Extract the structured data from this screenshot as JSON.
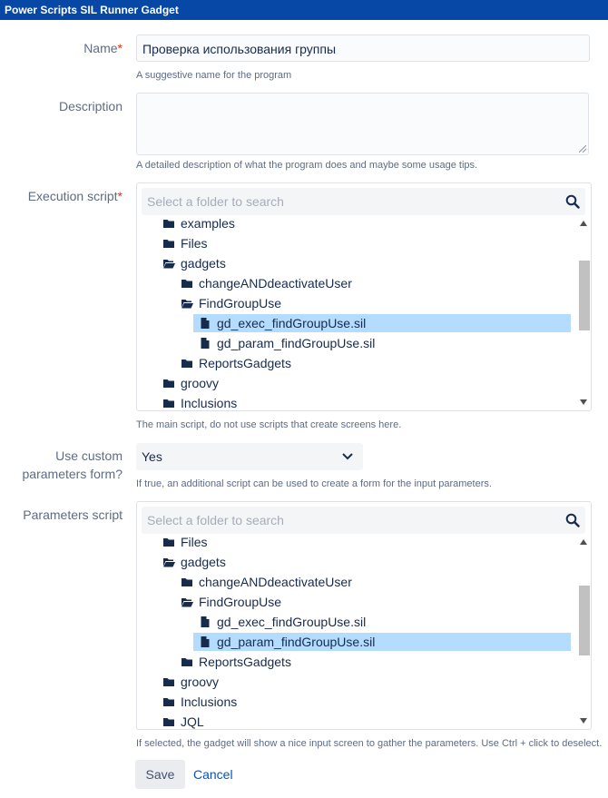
{
  "title": "Power Scripts SIL Runner Gadget",
  "name": {
    "label": "Name",
    "required": "*",
    "value": "Проверка использования группы",
    "hint": "A suggestive name for the program"
  },
  "description": {
    "label": "Description",
    "value": "",
    "hint": "A detailed description of what the program does and maybe some usage tips."
  },
  "execution_script": {
    "label": "Execution script",
    "required": "*",
    "search_placeholder": "Select a folder to search",
    "items": [
      {
        "label": "examples",
        "type": "folder"
      },
      {
        "label": "Files",
        "type": "folder"
      },
      {
        "label": "gadgets",
        "type": "folder-open"
      },
      {
        "label": "changeANDdeactivateUser",
        "type": "folder"
      },
      {
        "label": "FindGroupUse",
        "type": "folder-open"
      },
      {
        "label": "gd_exec_findGroupUse.sil",
        "type": "file",
        "selected": true
      },
      {
        "label": "gd_param_findGroupUse.sil",
        "type": "file"
      },
      {
        "label": "ReportsGadgets",
        "type": "folder"
      },
      {
        "label": "groovy",
        "type": "folder"
      },
      {
        "label": "Inclusions",
        "type": "folder"
      }
    ],
    "hint": "The main script, do not use scripts that create screens here."
  },
  "custom_params": {
    "label_line1": "Use custom",
    "label_line2": "parameters form?",
    "value": "Yes",
    "hint": "If true, an additional script can be used to create a form for the input parameters."
  },
  "parameters_script": {
    "label": "Parameters script",
    "search_placeholder": "Select a folder to search",
    "items": [
      {
        "label": "Files",
        "type": "folder"
      },
      {
        "label": "gadgets",
        "type": "folder-open"
      },
      {
        "label": "changeANDdeactivateUser",
        "type": "folder"
      },
      {
        "label": "FindGroupUse",
        "type": "folder-open"
      },
      {
        "label": "gd_exec_findGroupUse.sil",
        "type": "file"
      },
      {
        "label": "gd_param_findGroupUse.sil",
        "type": "file",
        "selected": true
      },
      {
        "label": "ReportsGadgets",
        "type": "folder"
      },
      {
        "label": "groovy",
        "type": "folder"
      },
      {
        "label": "Inclusions",
        "type": "folder"
      },
      {
        "label": "JQL",
        "type": "folder"
      }
    ],
    "hint": "If selected, the gadget will show a nice input screen to gather the parameters. Use Ctrl + click to deselect."
  },
  "actions": {
    "save": "Save",
    "cancel": "Cancel"
  },
  "colors": {
    "titlebar": "#0747a6",
    "selection": "#b3dcff",
    "required": "#de350b",
    "link": "#0052cc"
  }
}
